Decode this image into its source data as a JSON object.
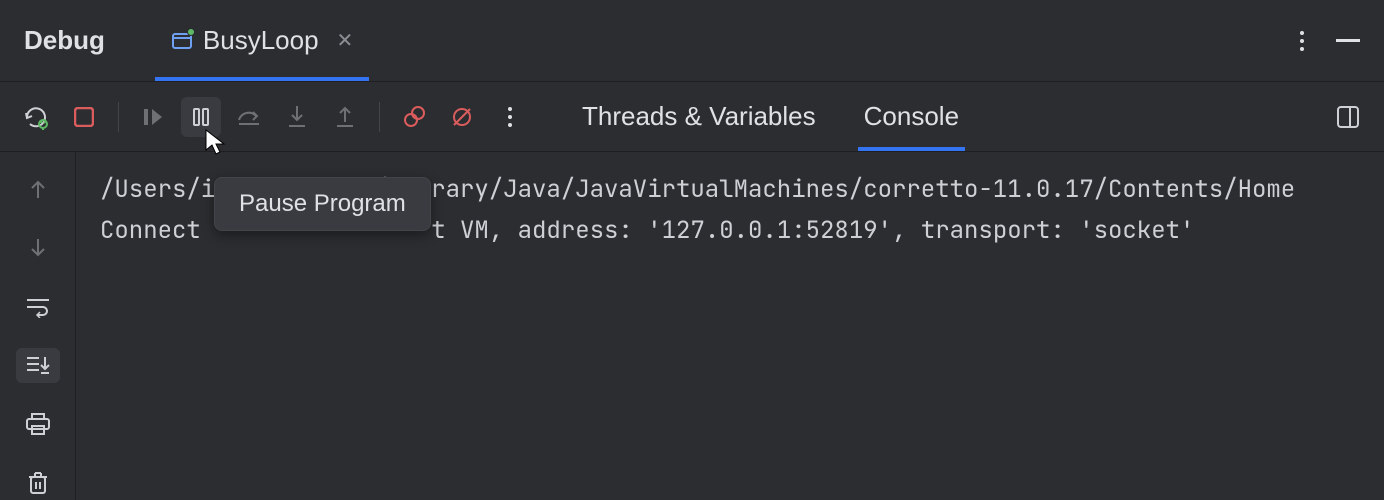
{
  "header": {
    "title": "Debug",
    "run_tab": "BusyLoop"
  },
  "toolbar_tabs": {
    "threads": "Threads & Variables",
    "console": "Console"
  },
  "tooltip": "Pause Program",
  "console": {
    "line1": "/Users/igor_kulakov/Library/Java/JavaVirtualMachines/corretto-11.0.17/Contents/Home",
    "line2_a": "Connect",
    "line2_b": "t VM, address: '127.0.0.1:52819', transport: 'socket'"
  }
}
